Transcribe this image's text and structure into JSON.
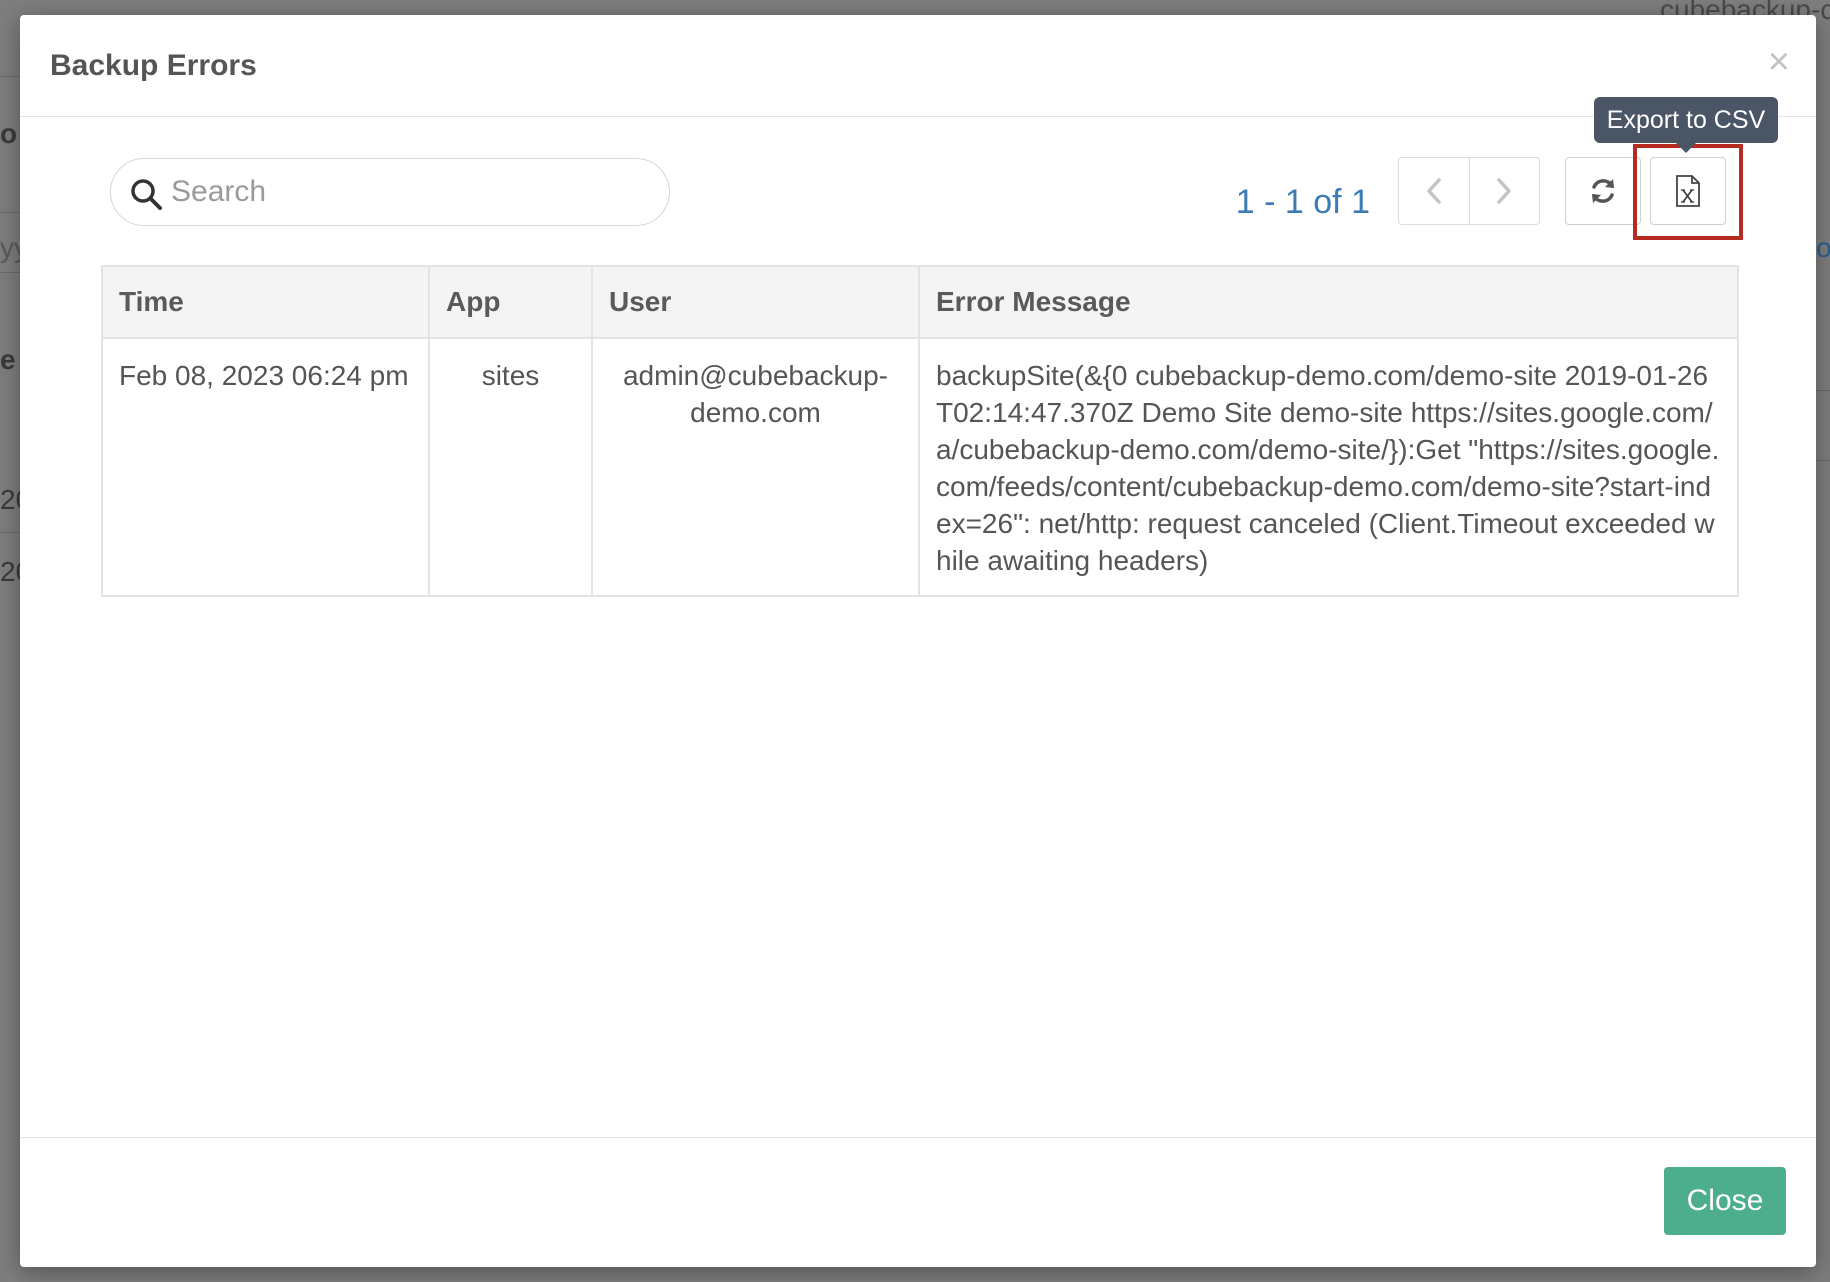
{
  "background": {
    "fragments": [
      "cubebackup-c",
      "o",
      "yy",
      "o",
      "e",
      "20",
      "20"
    ]
  },
  "modal": {
    "title": "Backup Errors",
    "close_symbol": "×"
  },
  "toolbar": {
    "search_placeholder": "Search",
    "search_value": "",
    "pagination_text": "1 - 1 of 1",
    "prev_icon": "chevron-left-icon",
    "next_icon": "chevron-right-icon",
    "refresh_icon": "refresh-icon",
    "export_icon": "excel-file-icon",
    "export_tooltip": "Export to CSV"
  },
  "table": {
    "headers": [
      "Time",
      "App",
      "User",
      "Error Message"
    ],
    "rows": [
      {
        "time": "Feb 08, 2023 06:24 pm",
        "app": "sites",
        "user": "admin@cubebackup-demo.com",
        "message": "backupSite(&{0 cubebackup-demo.com/demo-site 2019-01-26T02:14:47.370Z Demo Site demo-site https://sites.google.com/a/cubebackup-demo.com/demo-site/}):Get \"https://sites.google.com/feeds/content/cubebackup-demo.com/demo-site?start-index=26\": net/http: request canceled (Client.Timeout exceeded while awaiting headers)"
      }
    ]
  },
  "footer": {
    "close_label": "Close"
  },
  "colors": {
    "accent_link": "#3d7bb8",
    "close_button": "#4cae8c",
    "highlight": "#b52b1f",
    "tooltip_bg": "#4a5566"
  }
}
